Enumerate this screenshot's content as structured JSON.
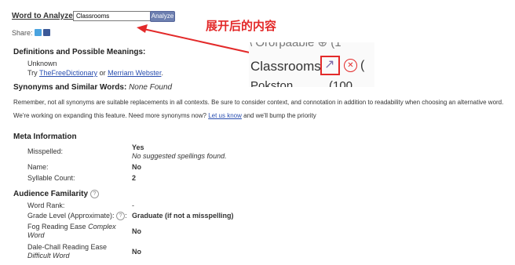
{
  "header": {
    "word_label": "Word to Analyze:",
    "input_value": "Classrooms",
    "analyze_label": "Analyze",
    "share_label": "Share:"
  },
  "annotation": {
    "text": "展开后的内容",
    "color": "#e32a2a"
  },
  "zoom_inset": {
    "top_fragment": "\\ Ororpaable ⊕ (1",
    "main_word": "Classrooms",
    "edit_glyph": "↗",
    "remove_glyph": "✕",
    "after_main": "(",
    "bottom_fragment": "Pokston",
    "bottom_suffix": "(100"
  },
  "definitions": {
    "title": "Definitions and Possible Meanings:",
    "unknown": "Unknown",
    "try_prefix": "Try",
    "link1": "TheFreeDictionary",
    "or": "or",
    "link2": "Merriam Webster",
    "period": "."
  },
  "synonyms": {
    "title": "Synonyms and Similar Words:",
    "none": "None Found",
    "note1": "Remember, not all synonyms are suitable replacements in all contexts. Be sure to consider context, and connotation in addition to readability when choosing an alternative word.",
    "note2_prefix": "We're working on expanding this feature. Need more synonyms now?",
    "note2_link": "Let us know",
    "note2_suffix": "and we'll bump the priority"
  },
  "meta": {
    "title": "Meta Information",
    "misspelled_label": "Misspelled:",
    "misspelled_value": "Yes",
    "misspelled_note": "No suggested spellings found.",
    "name_label": "Name:",
    "name_value": "No",
    "syllable_label": "Syllable Count:",
    "syllable_value": "2"
  },
  "audience": {
    "title": "Audience Familarity",
    "help_glyph": "?",
    "word_rank_label": "Word Rank:",
    "word_rank_value": "-",
    "grade_label": "Grade Level (Approximate):",
    "grade_value": "Graduate (if not a misspelling)",
    "fog_label": "Fog Reading Ease",
    "fog_italic": "Complex",
    "fog_label2": "Word",
    "fog_value": "No",
    "dale_label": "Dale-Chall Reading Ease",
    "dale_italic": "Difficult Word",
    "dale_value": "No"
  }
}
